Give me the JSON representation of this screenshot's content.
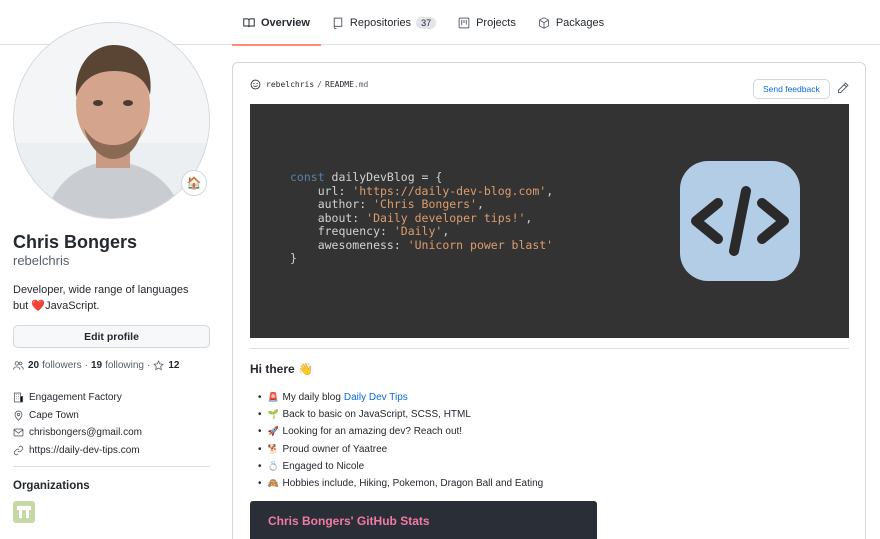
{
  "tabs": [
    {
      "label": "Overview",
      "icon": "book-icon",
      "active": true
    },
    {
      "label": "Repositories",
      "icon": "repo-icon",
      "count": "37"
    },
    {
      "label": "Projects",
      "icon": "project-icon"
    },
    {
      "label": "Packages",
      "icon": "package-icon"
    }
  ],
  "profile": {
    "full_name": "Chris Bongers",
    "username": "rebelchris",
    "bio_line1": "Developer, wide range of languages",
    "bio_line2_prefix": "but ",
    "bio_heart": "❤️",
    "bio_line2_suffix": "JavaScript.",
    "status_emoji": "🏠",
    "edit_profile_label": "Edit profile",
    "followers_count": "20",
    "followers_label": "followers",
    "dot": "·",
    "following_count": "19",
    "following_label": "following",
    "stars_count": "12",
    "company": "Engagement Factory",
    "location": "Cape Town",
    "email": "chrisbongers@gmail.com",
    "website": "https://daily-dev-tips.com",
    "organizations_title": "Organizations"
  },
  "readme": {
    "owner": "rebelchris",
    "separator": "/",
    "file_name": "README",
    "file_ext": ".md",
    "feedback_label": "Send feedback",
    "code": {
      "line1_kw": "const ",
      "line1_rest": "dailyDevBlog = {",
      "url_key": "    url: ",
      "url_val": "'https://daily-dev-blog.com'",
      "author_key": "    author: ",
      "author_val": "'Chris Bongers'",
      "about_key": "    about: ",
      "about_val": "'Daily developer tips!'",
      "frequency_key": "    frequency: ",
      "frequency_val": "'Daily'",
      "awesome_key": "    awesomeness: ",
      "awesome_val": "'Unicorn power blast'",
      "comma": ",",
      "close": "}"
    },
    "greeting": "Hi there 👋",
    "items": [
      {
        "emoji": "🚨",
        "text": "My daily blog",
        "link": "Daily Dev Tips"
      },
      {
        "emoji": "🌱",
        "text": "Back to basic on JavaScript, SCSS, HTML"
      },
      {
        "emoji": "🚀",
        "text": "Looking for an amazing dev? Reach out!"
      },
      {
        "emoji": "🐕",
        "text": "Proud owner of Yaatree"
      },
      {
        "emoji": "💍",
        "text": "Engaged to Nicole"
      },
      {
        "emoji": "🙈",
        "text": "Hobbies include, Hiking, Pokemon, Dragon Ball and Eating"
      }
    ],
    "stats_title": "Chris Bongers' GitHub Stats"
  },
  "colors": {
    "accent_tab": "#fd8c73",
    "link": "#0969da",
    "banner_bg": "#333333",
    "badge_bg": "#b3cde6",
    "stats_title": "#f07ba3"
  }
}
